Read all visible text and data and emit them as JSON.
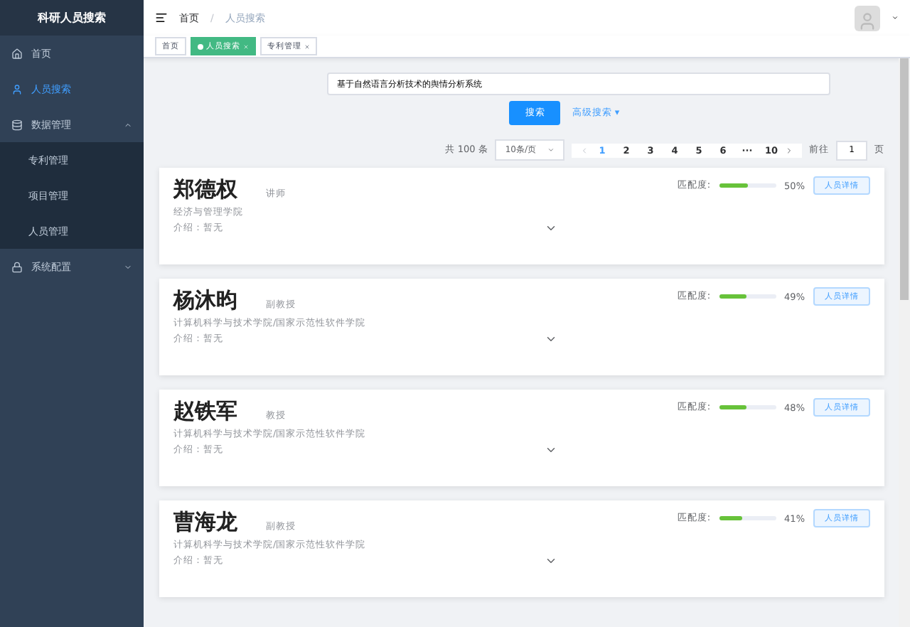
{
  "sidebar": {
    "title": "科研人员搜索",
    "items": [
      {
        "label": "首页",
        "selected": false
      },
      {
        "label": "人员搜索",
        "selected": true
      },
      {
        "label": "数据管理",
        "selected": false,
        "expanded": true,
        "children": [
          {
            "label": "专利管理",
            "selected": false
          },
          {
            "label": "项目管理",
            "selected": false
          },
          {
            "label": "人员管理",
            "selected": false
          }
        ]
      },
      {
        "label": "系统配置",
        "selected": false,
        "expanded": false
      }
    ]
  },
  "breadcrumb": [
    "首页",
    "人员搜索"
  ],
  "breadcrumb_separator": "/",
  "tags": [
    {
      "label": "首页",
      "selected": false,
      "closable": false
    },
    {
      "label": "人员搜索",
      "selected": true,
      "closable": true
    },
    {
      "label": "专利管理",
      "selected": false,
      "closable": true
    }
  ],
  "search": {
    "value": "基于自然语言分析技术的舆情分析系统",
    "button": "搜索",
    "advanced": "高级搜索",
    "advanced_caret": "▾"
  },
  "pagination": {
    "total": "共 100 条",
    "page_size": "10条/页",
    "pages": [
      {
        "label": "1",
        "selected": true
      },
      {
        "label": "2",
        "selected": false
      },
      {
        "label": "3",
        "selected": false
      },
      {
        "label": "4",
        "selected": false
      },
      {
        "label": "5",
        "selected": false
      },
      {
        "label": "6",
        "selected": false
      },
      {
        "label": "···",
        "selected": false
      },
      {
        "label": "10",
        "selected": false
      }
    ],
    "goto_label": "前往",
    "goto_value": "1",
    "goto_unit": "页"
  },
  "people": [
    {
      "name": "郑德权",
      "title": "讲师",
      "college": "经济与管理学院",
      "intro": "介绍：暂无",
      "match_label": "匹配度:",
      "level": 0.5,
      "reading": "50%",
      "button": "人员详情"
    },
    {
      "name": "杨沐昀",
      "title": "副教授",
      "college": "计算机科学与技术学院/国家示范性软件学院",
      "intro": "介绍：暂无",
      "match_label": "匹配度:",
      "level": 0.49,
      "reading": "49%",
      "button": "人员详情"
    },
    {
      "name": "赵铁军",
      "title": "教授",
      "college": "计算机科学与技术学院/国家示范性软件学院",
      "intro": "介绍：暂无",
      "match_label": "匹配度:",
      "level": 0.48,
      "reading": "48%",
      "button": "人员详情"
    },
    {
      "name": "曹海龙",
      "title": "副教授",
      "college": "计算机科学与技术学院/国家示范性软件学院",
      "intro": "介绍：暂无",
      "match_label": "匹配度:",
      "level": 0.41,
      "reading": "41%",
      "button": "人员详情"
    }
  ]
}
